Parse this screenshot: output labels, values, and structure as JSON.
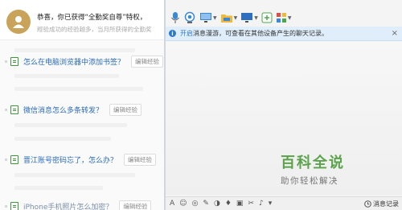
{
  "banner": {
    "line1": "恭喜，你已获得“全勤奖自尊”特权，",
    "line2": "經验成功的经验越多，当月所获得的全勤奖"
  },
  "articles": [
    {
      "title": "怎么在电脑浏览器中添加书签？",
      "edit_label": "编辑经验"
    },
    {
      "title": "微信消息怎么多条转发？",
      "edit_label": "编辑经验"
    },
    {
      "title": "晋江账号密码忘了，怎么办？",
      "edit_label": "编辑经验"
    },
    {
      "title": "iPhone手机照片怎么加密？",
      "edit_label": "编辑经验"
    }
  ],
  "infobar": {
    "link": "开启",
    "text": "消息漫游，可查看在其他设备产生的聊天记录。",
    "close": "×"
  },
  "watermark": {
    "title": "百科全说",
    "subtitle": "助你轻松解决"
  },
  "inputbar": {
    "history_label": "消息记录"
  },
  "colors": {
    "link_blue": "#2a6bb8",
    "info_bg": "#dfeefa",
    "watermark_green": "#5aa34a"
  }
}
